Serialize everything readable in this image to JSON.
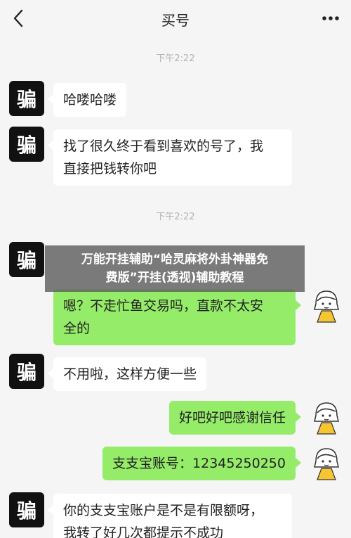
{
  "header": {
    "title": "买号"
  },
  "colors": {
    "background": "#f5f5f5",
    "bubble_left": "#ffffff",
    "bubble_right": "#95ec69",
    "avatar_left": "#111111",
    "time": "#b4b4b4"
  },
  "icons": {
    "back": "chevron-left-icon",
    "more": "more-dots-icon",
    "avatar_left": "scammer-avatar-icon",
    "avatar_right": "cartoon-girl-avatar-icon"
  },
  "avatar_left_char": "骗",
  "times": [
    "下午2:22",
    "下午2:22"
  ],
  "messages": [
    {
      "line1": "哈喽哈喽"
    },
    {
      "line1": "找了很久终于看到喜欢的号了，我",
      "line2": "直接把钱转你吧"
    },
    {
      "line1": "嗯？不走忙鱼交易吗，直款不太安",
      "line2": "全的"
    },
    {
      "line1": "不用啦，这样方便一些"
    },
    {
      "line1": "好吧好吧感谢信任"
    },
    {
      "line1": "支支宝账号：12345250250"
    },
    {
      "line1": "你的支支宝账户是不是有限额呀，",
      "line2": "我转了好几次都提示不成功"
    }
  ],
  "overlay": {
    "line1": "万能开挂辅助“哈灵麻将外卦神器免",
    "line2": "费版”开挂(透视)辅助教程"
  }
}
